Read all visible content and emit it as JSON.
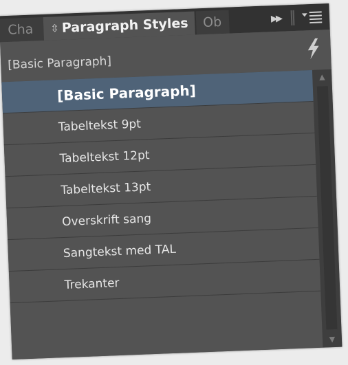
{
  "tabs": {
    "character": "Cha",
    "paragraph_styles": "Paragraph Styles",
    "object": "Ob"
  },
  "icons": {
    "tab_sort": "up-down-arrows-icon",
    "collapse": "double-right-arrow-icon",
    "menu": "panel-menu-icon",
    "lightning": "lightning-icon",
    "scroll_up": "triangle-up-icon",
    "scroll_down": "triangle-down-icon"
  },
  "current_style": "[Basic Paragraph]",
  "styles": [
    {
      "label": "[Basic Paragraph]",
      "selected": true
    },
    {
      "label": "Tabeltekst 9pt",
      "selected": false
    },
    {
      "label": "Tabeltekst 12pt",
      "selected": false
    },
    {
      "label": "Tabeltekst 13pt",
      "selected": false
    },
    {
      "label": "Overskrift sang",
      "selected": false
    },
    {
      "label": "Sangtekst med TAL",
      "selected": false
    },
    {
      "label": "Trekanter",
      "selected": false
    }
  ],
  "colors": {
    "panel_bg": "#535353",
    "tabbar_bg": "#323232",
    "selection": "#4f6378",
    "text": "#e6e6e6"
  }
}
